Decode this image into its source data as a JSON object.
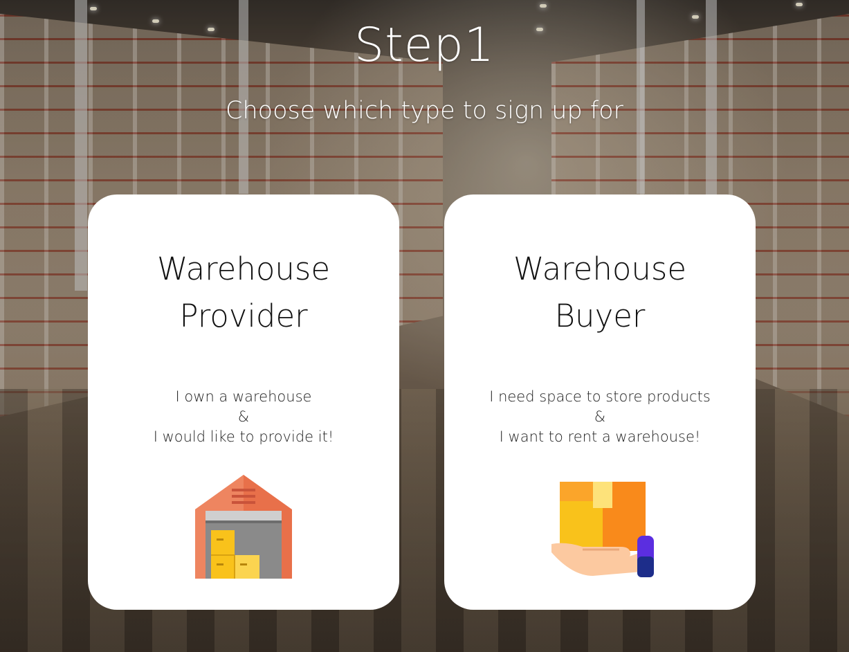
{
  "header": {
    "title": "Step1",
    "subtitle": "Choose which type to sign up for"
  },
  "cards": [
    {
      "title_line1": "Warehouse",
      "title_line2": "Provider",
      "desc_line1": "I own a warehouse",
      "desc_line2": "&",
      "desc_line3": "I would like to provide it!",
      "icon": "warehouse-icon"
    },
    {
      "title_line1": "Warehouse",
      "title_line2": "Buyer",
      "desc_line1": "I need space to store products",
      "desc_line2": "&",
      "desc_line3": "I want to rent a warehouse!",
      "icon": "box-in-hand-icon"
    }
  ],
  "colors": {
    "card_background": "#ffffff",
    "warehouse_roof": "#e8704a",
    "box_yellow": "#f9c21b",
    "box_orange": "#f98a1b",
    "hand_skin": "#fcc9a0",
    "cuff_purple": "#5b2ee0"
  }
}
